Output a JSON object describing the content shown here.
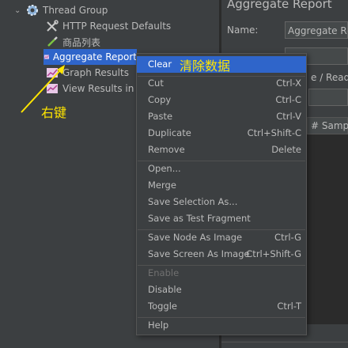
{
  "tree": {
    "items": [
      {
        "label": "Thread Group",
        "icon": "gear-icon"
      },
      {
        "label": "HTTP Request Defaults",
        "icon": "wrench-icon"
      },
      {
        "label": "商品列表",
        "icon": "pipette-icon"
      },
      {
        "label": "Aggregate Report",
        "icon": "report-icon"
      },
      {
        "label": "Graph Results",
        "icon": "graph-icon"
      },
      {
        "label": "View Results in Ta",
        "icon": "results-icon"
      }
    ]
  },
  "panel": {
    "title": "Aggregate Report",
    "name_label": "Name:",
    "name_value": "Aggregate Repo",
    "file_text": "e / Read fr",
    "table_header": "# Sample"
  },
  "context_menu": {
    "items": [
      {
        "label": "Clear",
        "shortcut": "",
        "highlighted": true
      },
      {
        "label": "Cut",
        "shortcut": "Ctrl-X"
      },
      {
        "label": "Copy",
        "shortcut": "Ctrl-C"
      },
      {
        "label": "Paste",
        "shortcut": "Ctrl-V"
      },
      {
        "label": "Duplicate",
        "shortcut": "Ctrl+Shift-C"
      },
      {
        "label": "Remove",
        "shortcut": "Delete"
      },
      {
        "label": "Open...",
        "shortcut": ""
      },
      {
        "label": "Merge",
        "shortcut": ""
      },
      {
        "label": "Save Selection As...",
        "shortcut": ""
      },
      {
        "label": "Save as Test Fragment",
        "shortcut": ""
      },
      {
        "label": "Save Node As Image",
        "shortcut": "Ctrl-G"
      },
      {
        "label": "Save Screen As Image",
        "shortcut": "Ctrl+Shift-G"
      },
      {
        "label": "Enable",
        "shortcut": "",
        "disabled": true
      },
      {
        "label": "Disable",
        "shortcut": ""
      },
      {
        "label": "Toggle",
        "shortcut": "Ctrl-T"
      },
      {
        "label": "Help",
        "shortcut": ""
      }
    ]
  },
  "annotations": {
    "clear_note": "清除数据",
    "right_click_note": "右键",
    "color": "#ffe500"
  },
  "colors": {
    "selection": "#2f65ca",
    "background": "#3c3f41",
    "text": "#bbbbbb"
  }
}
